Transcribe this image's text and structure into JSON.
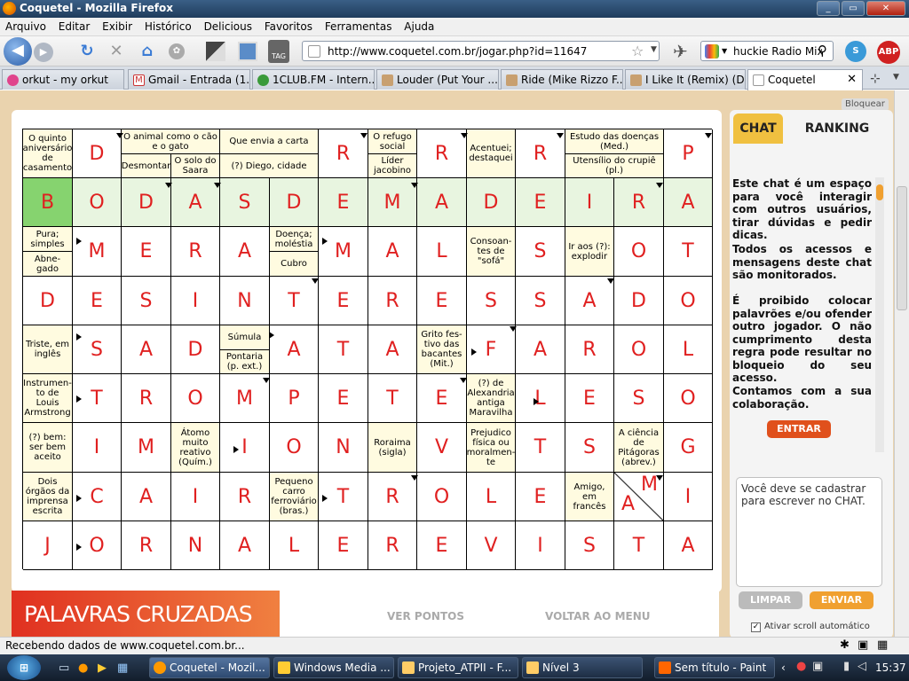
{
  "window": {
    "title": "Coquetel - Mozilla Firefox"
  },
  "menu": [
    "Arquivo",
    "Editar",
    "Exibir",
    "Histórico",
    "Delicious",
    "Favoritos",
    "Ferramentas",
    "Ajuda"
  ],
  "nav": {
    "url": "http://www.coquetel.com.br/jogar.php?id=11647",
    "search": "huckie Radio Mix)",
    "tag_label": "TAG"
  },
  "tabs": [
    {
      "label": "orkut - my orkut"
    },
    {
      "label": "Gmail - Entrada (1..."
    },
    {
      "label": "1CLUB.FM - Intern..."
    },
    {
      "label": "Louder (Put Your ..."
    },
    {
      "label": "Ride (Mike Rizzo F..."
    },
    {
      "label": "I Like It (Remix) (D..."
    },
    {
      "label": "Coquetel"
    }
  ],
  "page": {
    "bloquear": "Bloquear",
    "logo": "PALAVRAS CRUZADAS",
    "ver_pontos": "VER PONTOS",
    "voltar": "VOLTAR AO MENU",
    "chat_tab": "CHAT",
    "ranking_tab": "RANKING",
    "chat_info": "Este chat é um espaço para você interagir com outros usuários, tirar dúvidas e pedir dicas.",
    "chat_info2": "Todos os acessos e mensagens deste chat são monitorados.",
    "chat_info3": "É proibido colocar palavrões e/ou ofender outro jogador. O não cumprimento desta regra pode resultar no bloqueio do seu acesso.",
    "chat_info4": "Contamos com a sua colaboração.",
    "entrar": "ENTRAR",
    "msg_placeholder": "Você deve se cadastrar para escrever no CHAT.",
    "limpar": "LIMPAR",
    "enviar": "ENVIAR",
    "autoscroll": "Ativar scroll automático"
  },
  "grid": {
    "rows": [
      [
        {
          "c": "O quinto aniversário de casamento"
        },
        {
          "l": "D"
        },
        {
          "c2": [
            "O animal como o cão e o gato",
            "Desmontar"
          ]
        },
        {
          "c2b": "O solo do Saara"
        },
        {
          "c2": [
            "Que envia a carta",
            "(?) Diego, cidade"
          ]
        },
        {
          "x": ""
        },
        {
          "l": "R"
        },
        {
          "c2": [
            "O refugo social",
            "Líder jacobino"
          ]
        },
        {
          "l": "R"
        },
        {
          "c": "Acentuei; destaquei"
        },
        {
          "l": "R"
        },
        {
          "c2": [
            "Estudo das doenças (Med.)",
            "Utensílio do crupiê (pl.)"
          ]
        },
        {
          "x": ""
        },
        {
          "l": "P"
        }
      ],
      [
        {
          "l": "B",
          "sel": true
        },
        {
          "l": "O"
        },
        {
          "l": "D"
        },
        {
          "l": "A"
        },
        {
          "l": "S"
        },
        {
          "l": "D"
        },
        {
          "l": "E"
        },
        {
          "l": "M"
        },
        {
          "l": "A"
        },
        {
          "l": "D"
        },
        {
          "l": "E"
        },
        {
          "l": "I"
        },
        {
          "l": "R"
        },
        {
          "l": "A"
        }
      ],
      [
        {
          "c2": [
            "Pura; simples",
            "Abne-gado"
          ]
        },
        {
          "l": "M"
        },
        {
          "l": "E"
        },
        {
          "l": "R"
        },
        {
          "l": "A"
        },
        {
          "c2": [
            "Doença; moléstia",
            "Cubro"
          ]
        },
        {
          "l": "M"
        },
        {
          "l": "A"
        },
        {
          "l": "L"
        },
        {
          "c": "Consoan-tes de \"sofá\""
        },
        {
          "l": "S"
        },
        {
          "c": "Ir aos (?): explodir"
        },
        {
          "l": "O"
        },
        {
          "l": "T"
        }
      ],
      [
        {
          "l": "D"
        },
        {
          "l": "E"
        },
        {
          "l": "S"
        },
        {
          "l": "I"
        },
        {
          "l": "N"
        },
        {
          "l": "T"
        },
        {
          "l": "E"
        },
        {
          "l": "R"
        },
        {
          "l": "E"
        },
        {
          "l": "S"
        },
        {
          "l": "S"
        },
        {
          "l": "A"
        },
        {
          "l": "D"
        },
        {
          "l": "O"
        }
      ],
      [
        {
          "c": "Triste, em inglês"
        },
        {
          "l": "S"
        },
        {
          "l": "A"
        },
        {
          "l": "D"
        },
        {
          "c2": [
            "Súmula",
            "Pontaria (p. ext.)"
          ]
        },
        {
          "l": "A"
        },
        {
          "l": "T"
        },
        {
          "l": "A"
        },
        {
          "c": "Grito fes-tivo das bacantes (Mit.)"
        },
        {
          "l": "F"
        },
        {
          "l": "A"
        },
        {
          "l": "R"
        },
        {
          "l": "O"
        },
        {
          "l": "L"
        }
      ],
      [
        {
          "c": "Instrumen-to de Louis Armstrong"
        },
        {
          "l": "T"
        },
        {
          "l": "R"
        },
        {
          "l": "O"
        },
        {
          "l": "M"
        },
        {
          "l": "P"
        },
        {
          "l": "E"
        },
        {
          "l": "T"
        },
        {
          "l": "E"
        },
        {
          "c": "(?) de Alexandria antiga Maravilha"
        },
        {
          "l": "L"
        },
        {
          "l": "E"
        },
        {
          "l": "S"
        },
        {
          "l": "O"
        }
      ],
      [
        {
          "c": "(?) bem: ser bem aceito"
        },
        {
          "l": "I"
        },
        {
          "l": "M"
        },
        {
          "c": "Átomo muito reativo (Quím.)"
        },
        {
          "l": "I"
        },
        {
          "l": "O"
        },
        {
          "l": "N"
        },
        {
          "c": "Roraima (sigla)"
        },
        {
          "l": "V"
        },
        {
          "c": "Prejudico física ou moralmen-te"
        },
        {
          "l": "T"
        },
        {
          "l": "S"
        },
        {
          "c": "A ciência de Pitágoras (abrev.)"
        },
        {
          "l": "G"
        }
      ],
      [
        {
          "c": "Dois órgãos da imprensa escrita"
        },
        {
          "l": "C"
        },
        {
          "l": "A"
        },
        {
          "l": "I"
        },
        {
          "l": "R"
        },
        {
          "c": "Pequeno carro ferroviário (bras.)"
        },
        {
          "l": "T"
        },
        {
          "l": "R"
        },
        {
          "l": "O"
        },
        {
          "l": "L"
        },
        {
          "l": "E"
        },
        {
          "c": "Amigo, em francês"
        },
        {
          "d": [
            "M",
            "A"
          ]
        },
        {
          "l": "I"
        }
      ],
      [
        {
          "l": "J"
        },
        {
          "l": "O"
        },
        {
          "l": "R"
        },
        {
          "l": "N"
        },
        {
          "l": "A"
        },
        {
          "l": "L"
        },
        {
          "l": "E"
        },
        {
          "l": "R"
        },
        {
          "l": "E"
        },
        {
          "l": "V"
        },
        {
          "l": "I"
        },
        {
          "l": "S"
        },
        {
          "l": "T"
        },
        {
          "l": "A"
        }
      ]
    ]
  },
  "status": {
    "text": "Recebendo dados de www.coquetel.com.br..."
  },
  "taskbar": {
    "items": [
      {
        "label": "Coquetel - Mozil..."
      },
      {
        "label": "Windows Media ..."
      },
      {
        "label": "Projeto_ATPII - F..."
      },
      {
        "label": "Nível 3"
      },
      {
        "label": "Sem título - Paint"
      }
    ],
    "clock": "15:37"
  }
}
